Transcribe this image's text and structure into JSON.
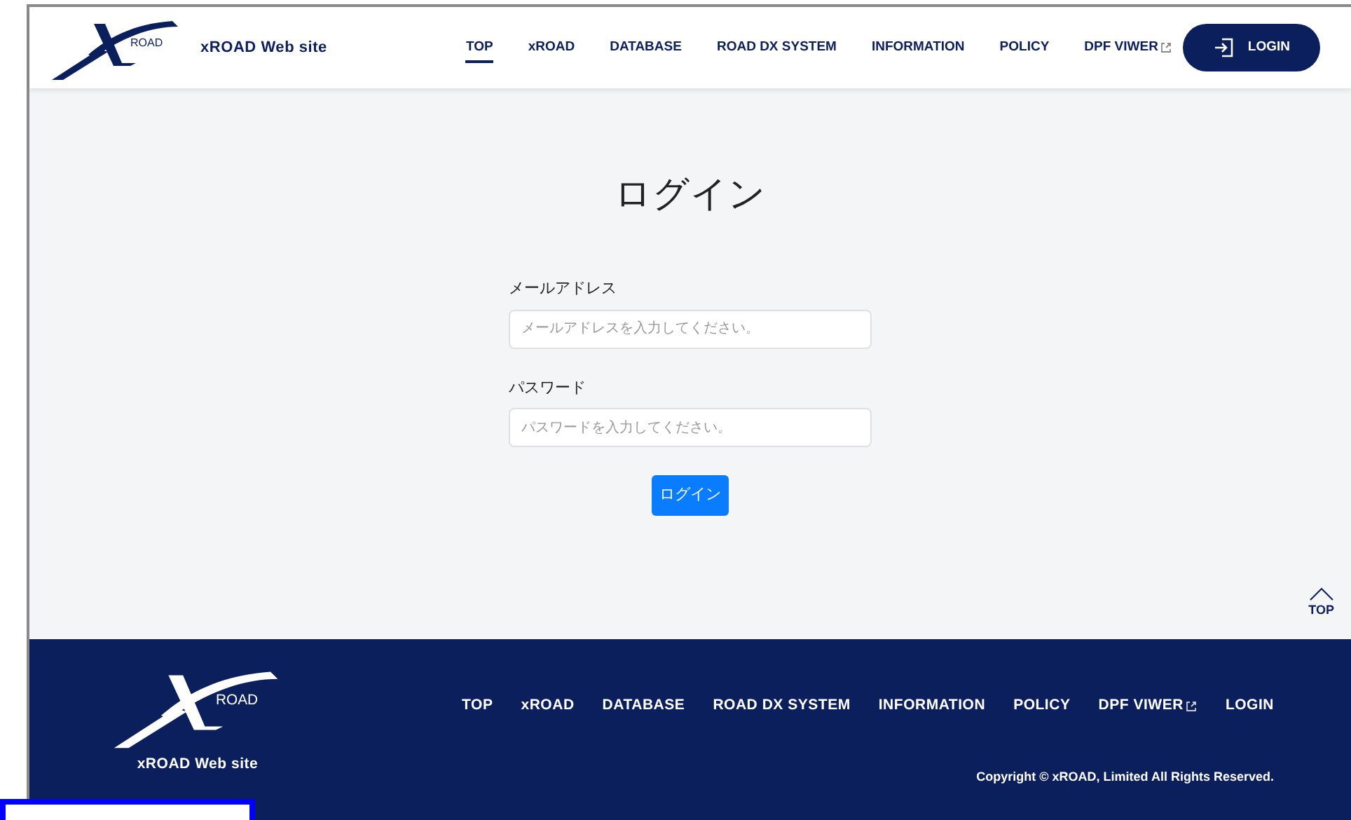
{
  "header": {
    "logo_text": "ROAD",
    "site_name": "xROAD Web site",
    "nav": [
      {
        "label": "TOP",
        "selected": true,
        "external": false
      },
      {
        "label": "xROAD",
        "selected": false,
        "external": false
      },
      {
        "label": "DATABASE",
        "selected": false,
        "external": false
      },
      {
        "label": "ROAD DX SYSTEM",
        "selected": false,
        "external": false
      },
      {
        "label": "INFORMATION",
        "selected": false,
        "external": false
      },
      {
        "label": "POLICY",
        "selected": false,
        "external": false
      },
      {
        "label": "DPF VIWER",
        "selected": false,
        "external": true
      }
    ],
    "login_button": "LOGIN"
  },
  "login_form": {
    "title": "ログイン",
    "fields": [
      {
        "label": "メールアドレス",
        "placeholder": "メールアドレスを入力してください。"
      },
      {
        "label": "パスワード",
        "placeholder": "パスワードを入力してください。"
      }
    ],
    "submit": "ログイン"
  },
  "back_to_top": "TOP",
  "footer": {
    "logo_text": "ROAD",
    "site_name": "xROAD Web site",
    "nav": [
      {
        "label": "TOP",
        "external": false
      },
      {
        "label": "xROAD",
        "external": false
      },
      {
        "label": "DATABASE",
        "external": false
      },
      {
        "label": "ROAD DX SYSTEM",
        "external": false
      },
      {
        "label": "INFORMATION",
        "external": false
      },
      {
        "label": "POLICY",
        "external": false
      },
      {
        "label": "DPF VIWER",
        "external": true
      },
      {
        "label": "LOGIN",
        "external": false
      }
    ],
    "copyright": "Copyright © xROAD, Limited All Rights Reserved."
  }
}
